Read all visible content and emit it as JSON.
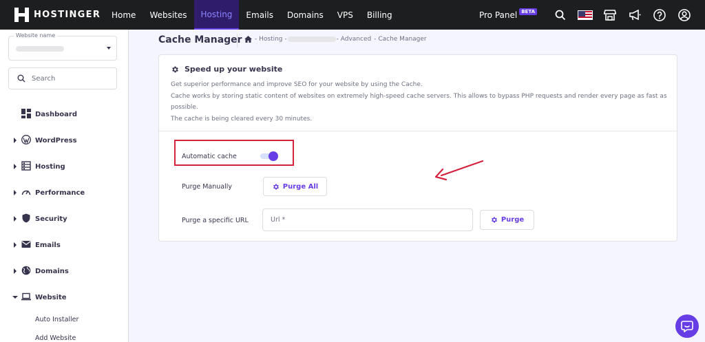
{
  "brand": {
    "name": "HOSTINGER"
  },
  "nav": {
    "links": [
      {
        "label": "Home",
        "active": false
      },
      {
        "label": "Websites",
        "active": false
      },
      {
        "label": "Hosting",
        "active": true
      },
      {
        "label": "Emails",
        "active": false
      },
      {
        "label": "Domains",
        "active": false
      },
      {
        "label": "VPS",
        "active": false
      },
      {
        "label": "Billing",
        "active": false
      }
    ],
    "pro_panel": "Pro Panel",
    "beta": "BETA",
    "icons": [
      "search-icon",
      "us-flag-icon",
      "store-icon",
      "megaphone-icon",
      "help-icon",
      "account-icon"
    ]
  },
  "sidebar": {
    "site_select": {
      "label": "Website name",
      "value": ""
    },
    "search": {
      "placeholder": "Search"
    },
    "items": [
      {
        "label": "Dashboard",
        "icon": "dashboard-icon",
        "expandable": false
      },
      {
        "label": "WordPress",
        "icon": "wordpress-icon",
        "expandable": true
      },
      {
        "label": "Hosting",
        "icon": "hosting-icon",
        "expandable": true
      },
      {
        "label": "Performance",
        "icon": "performance-icon",
        "expandable": true
      },
      {
        "label": "Security",
        "icon": "shield-icon",
        "expandable": true
      },
      {
        "label": "Emails",
        "icon": "mail-icon",
        "expandable": true
      },
      {
        "label": "Domains",
        "icon": "globe-icon",
        "expandable": true
      },
      {
        "label": "Website",
        "icon": "laptop-icon",
        "expandable": true,
        "expanded": true
      }
    ],
    "sub_items": [
      "Auto Installer",
      "Add Website"
    ]
  },
  "page": {
    "title": "Cache Manager",
    "breadcrumb": {
      "home_icon": "home-icon",
      "parts": [
        "- Hosting -",
        "- Advanced",
        "- Cache Manager"
      ]
    }
  },
  "card": {
    "title": "Speed up your website",
    "title_icon": "gear-icon",
    "desc_lines": [
      "Get superior performance and improve SEO for your website by using the Cache.",
      "Cache works by storing static content of websites on extremely high-speed cache servers. This allows to bypass PHP requests and render every page as fast as possible.",
      "The cache is being cleared every 30 minutes."
    ],
    "automatic_cache": {
      "label": "Automatic cache",
      "enabled": true
    },
    "purge_manually": {
      "label": "Purge Manually",
      "button": "Purge All"
    },
    "purge_url": {
      "label": "Purge a specific URL",
      "placeholder": "Url *",
      "button": "Purge"
    }
  },
  "colors": {
    "topbar": "#1d1e20",
    "accent": "#673de6",
    "annotation": "#d4213c",
    "background": "#f4f5ff"
  }
}
